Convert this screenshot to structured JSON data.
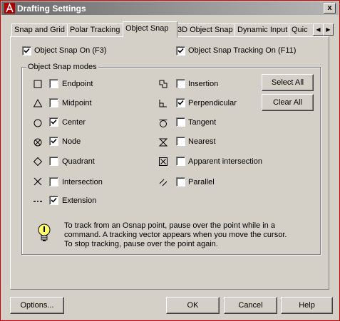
{
  "window": {
    "title": "Drafting Settings",
    "close_label": "x"
  },
  "tabs": [
    {
      "label": "Snap and Grid"
    },
    {
      "label": "Polar Tracking"
    },
    {
      "label": "Object Snap"
    },
    {
      "label": "3D Object Snap"
    },
    {
      "label": "Dynamic Input"
    },
    {
      "label": "Quic"
    }
  ],
  "tab_scroll": {
    "left": "◀",
    "right": "▶"
  },
  "top_options": {
    "snap_on": {
      "label": "Object Snap On (F3)",
      "checked": true
    },
    "tracking_on": {
      "label": "Object Snap Tracking On (F11)",
      "checked": true
    }
  },
  "group": {
    "title": "Object Snap modes"
  },
  "modes_left": [
    {
      "label": "Endpoint",
      "checked": false,
      "icon": "endpoint-icon"
    },
    {
      "label": "Midpoint",
      "checked": false,
      "icon": "midpoint-icon"
    },
    {
      "label": "Center",
      "checked": true,
      "icon": "center-icon"
    },
    {
      "label": "Node",
      "checked": true,
      "icon": "node-icon"
    },
    {
      "label": "Quadrant",
      "checked": false,
      "icon": "quadrant-icon"
    },
    {
      "label": "Intersection",
      "checked": false,
      "icon": "intersection-icon"
    },
    {
      "label": "Extension",
      "checked": true,
      "icon": "extension-icon"
    }
  ],
  "modes_right": [
    {
      "label": "Insertion",
      "checked": false,
      "icon": "insertion-icon"
    },
    {
      "label": "Perpendicular",
      "checked": true,
      "icon": "perpendicular-icon"
    },
    {
      "label": "Tangent",
      "checked": false,
      "icon": "tangent-icon"
    },
    {
      "label": "Nearest",
      "checked": false,
      "icon": "nearest-icon"
    },
    {
      "label": "Apparent intersection",
      "checked": false,
      "icon": "apparent-intersection-icon"
    },
    {
      "label": "Parallel",
      "checked": false,
      "icon": "parallel-icon"
    }
  ],
  "side_buttons": {
    "select_all": "Select All",
    "clear_all": "Clear All"
  },
  "info": {
    "icon": "lightbulb-icon",
    "line1": "To track from an Osnap point, pause over the point while in a",
    "line2": "command.  A tracking vector appears when you move the cursor.",
    "line3": "To stop tracking, pause over the point again."
  },
  "footer": {
    "options": "Options...",
    "ok": "OK",
    "cancel": "Cancel",
    "help": "Help"
  },
  "colors": {
    "dialog_bg": "#d4d0c8",
    "frame_border": "#cc0000",
    "title_bar": "#808080"
  }
}
